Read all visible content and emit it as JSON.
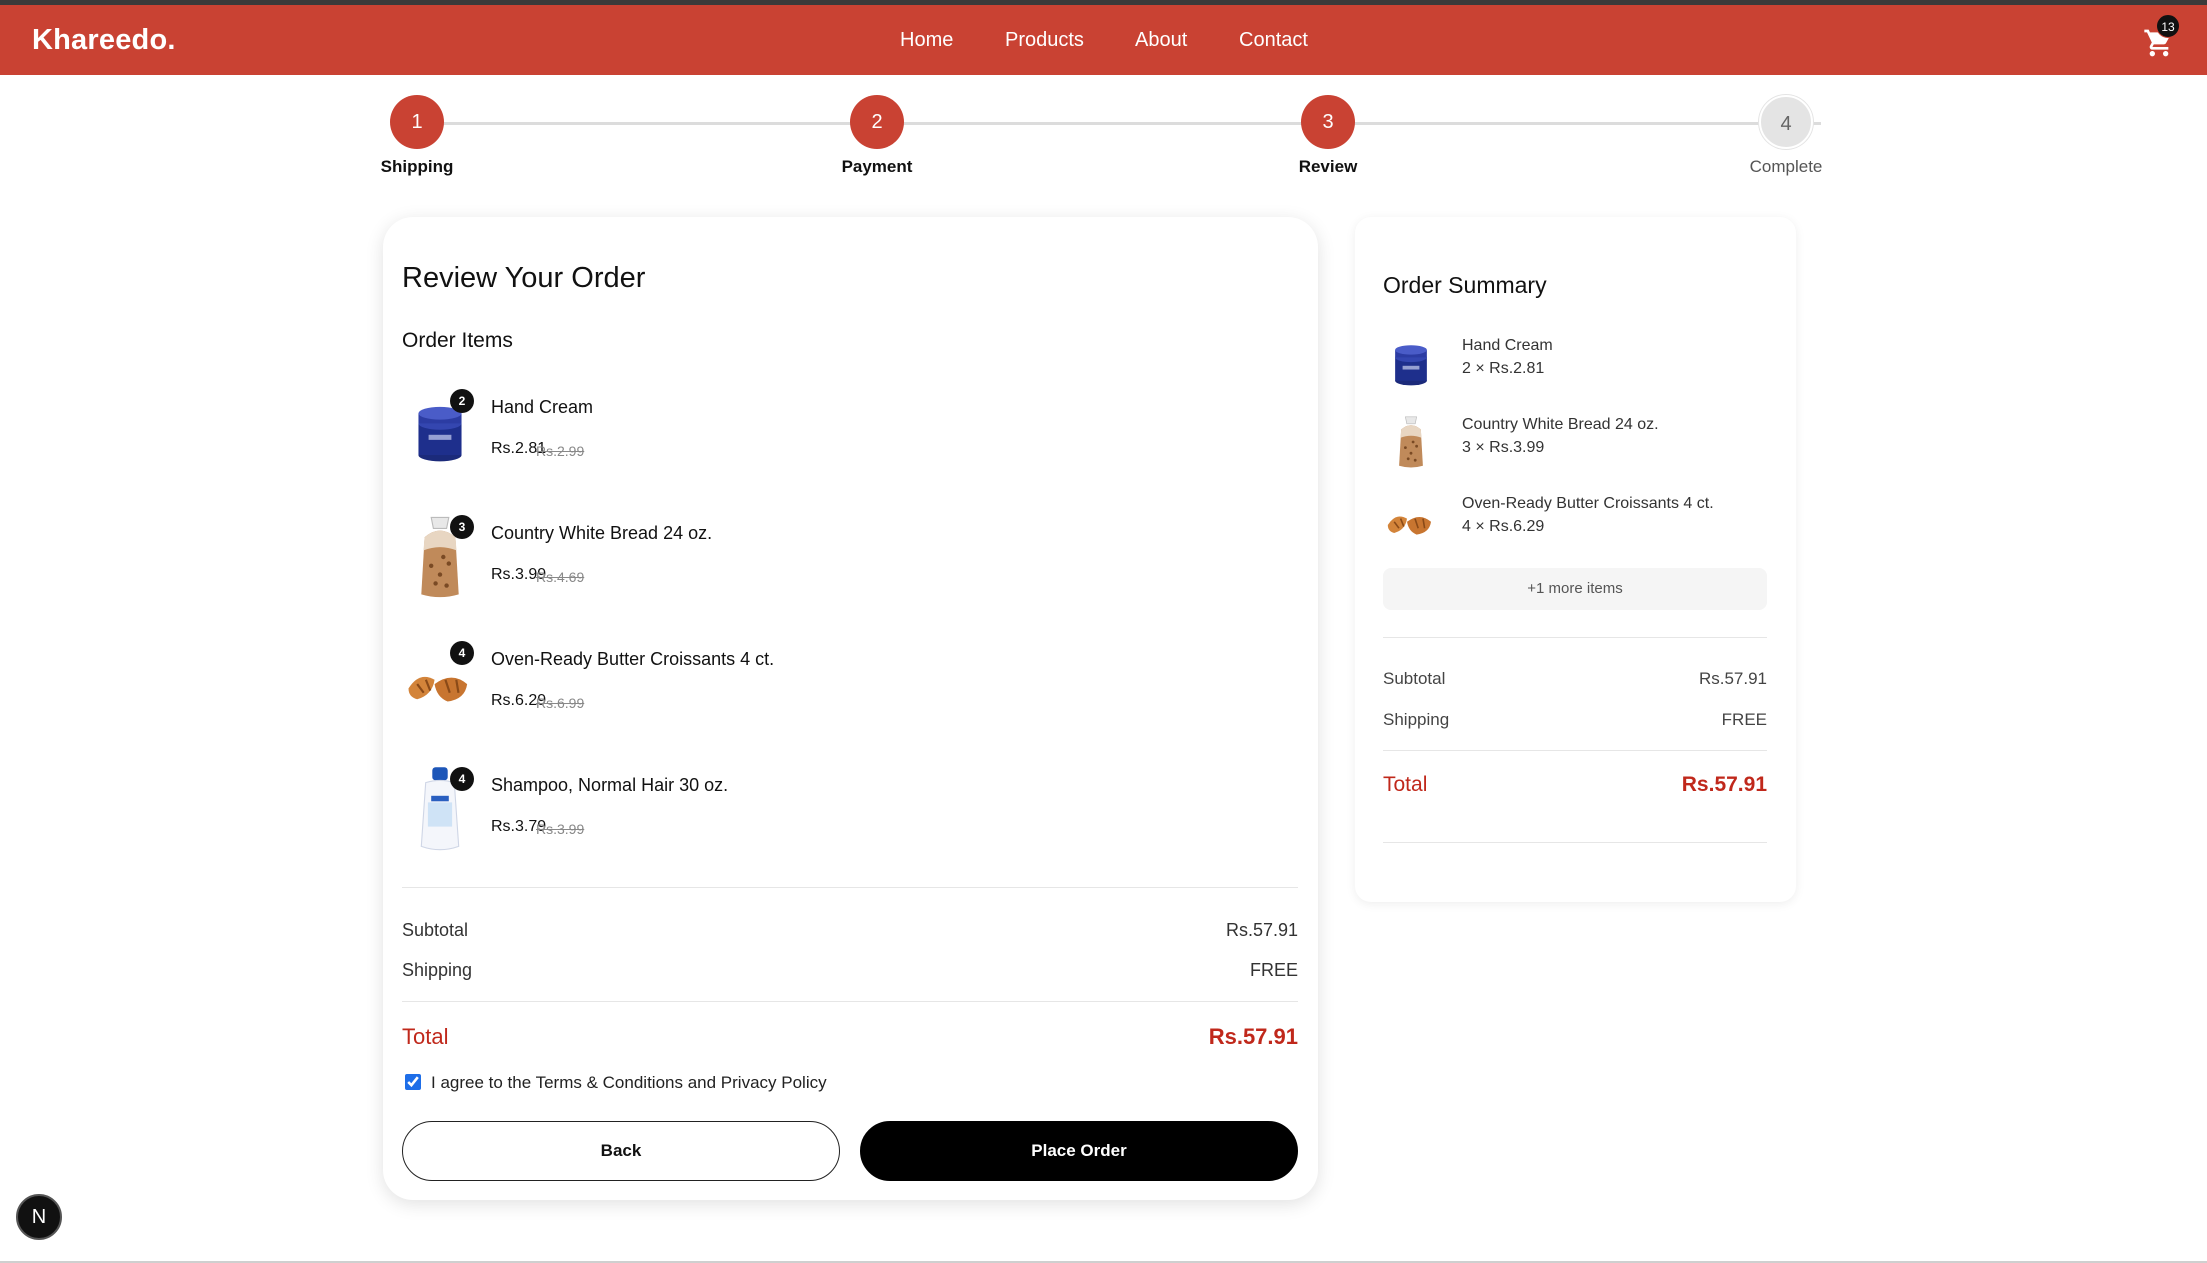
{
  "navbar": {
    "brand": "Khareedo.",
    "links": [
      "Home",
      "Products",
      "About",
      "Contact"
    ],
    "cart_count": "13"
  },
  "stepper": {
    "steps": [
      {
        "number": "1",
        "label": "Shipping",
        "state": "done"
      },
      {
        "number": "2",
        "label": "Payment",
        "state": "done"
      },
      {
        "number": "3",
        "label": "Review",
        "state": "current"
      },
      {
        "number": "4",
        "label": "Complete",
        "state": "pending"
      }
    ]
  },
  "review": {
    "title": "Review Your Order",
    "items_heading": "Order Items",
    "items": [
      {
        "name": "Hand Cream",
        "qty": "2",
        "price": "Rs.2.81",
        "old_price": "Rs.2.99",
        "icon": "hand-cream"
      },
      {
        "name": "Country White Bread 24 oz.",
        "qty": "3",
        "price": "Rs.3.99",
        "old_price": "Rs.4.69",
        "icon": "bread"
      },
      {
        "name": "Oven-Ready Butter Croissants 4 ct.",
        "qty": "4",
        "price": "Rs.6.29",
        "old_price": "Rs.6.99",
        "icon": "croissant"
      },
      {
        "name": "Shampoo, Normal Hair 30 oz.",
        "qty": "4",
        "price": "Rs.3.79",
        "old_price": "Rs.3.99",
        "icon": "shampoo"
      }
    ],
    "subtotal_label": "Subtotal",
    "subtotal_value": "Rs.57.91",
    "shipping_label": "Shipping",
    "shipping_value": "FREE",
    "total_label": "Total",
    "total_value": "Rs.57.91",
    "agree_text": "I agree to the Terms & Conditions and Privacy Policy",
    "agree_checked": true,
    "back_label": "Back",
    "place_label": "Place Order"
  },
  "summary": {
    "title": "Order Summary",
    "items": [
      {
        "name": "Hand Cream",
        "qty_line": "2 × Rs.2.81",
        "icon": "hand-cream"
      },
      {
        "name": "Country White Bread 24 oz.",
        "qty_line": "3 × Rs.3.99",
        "icon": "bread"
      },
      {
        "name": "Oven-Ready Butter Croissants 4 ct.",
        "qty_line": "4 × Rs.6.29",
        "icon": "croissant"
      }
    ],
    "more_label": "+1 more items",
    "subtotal_label": "Subtotal",
    "subtotal_value": "Rs.57.91",
    "shipping_label": "Shipping",
    "shipping_value": "FREE",
    "total_label": "Total",
    "total_value": "Rs.57.91"
  },
  "dev_badge": "N",
  "colors": {
    "brand": "#c94233",
    "total": "#c0281b",
    "primary_button": "#000000"
  }
}
